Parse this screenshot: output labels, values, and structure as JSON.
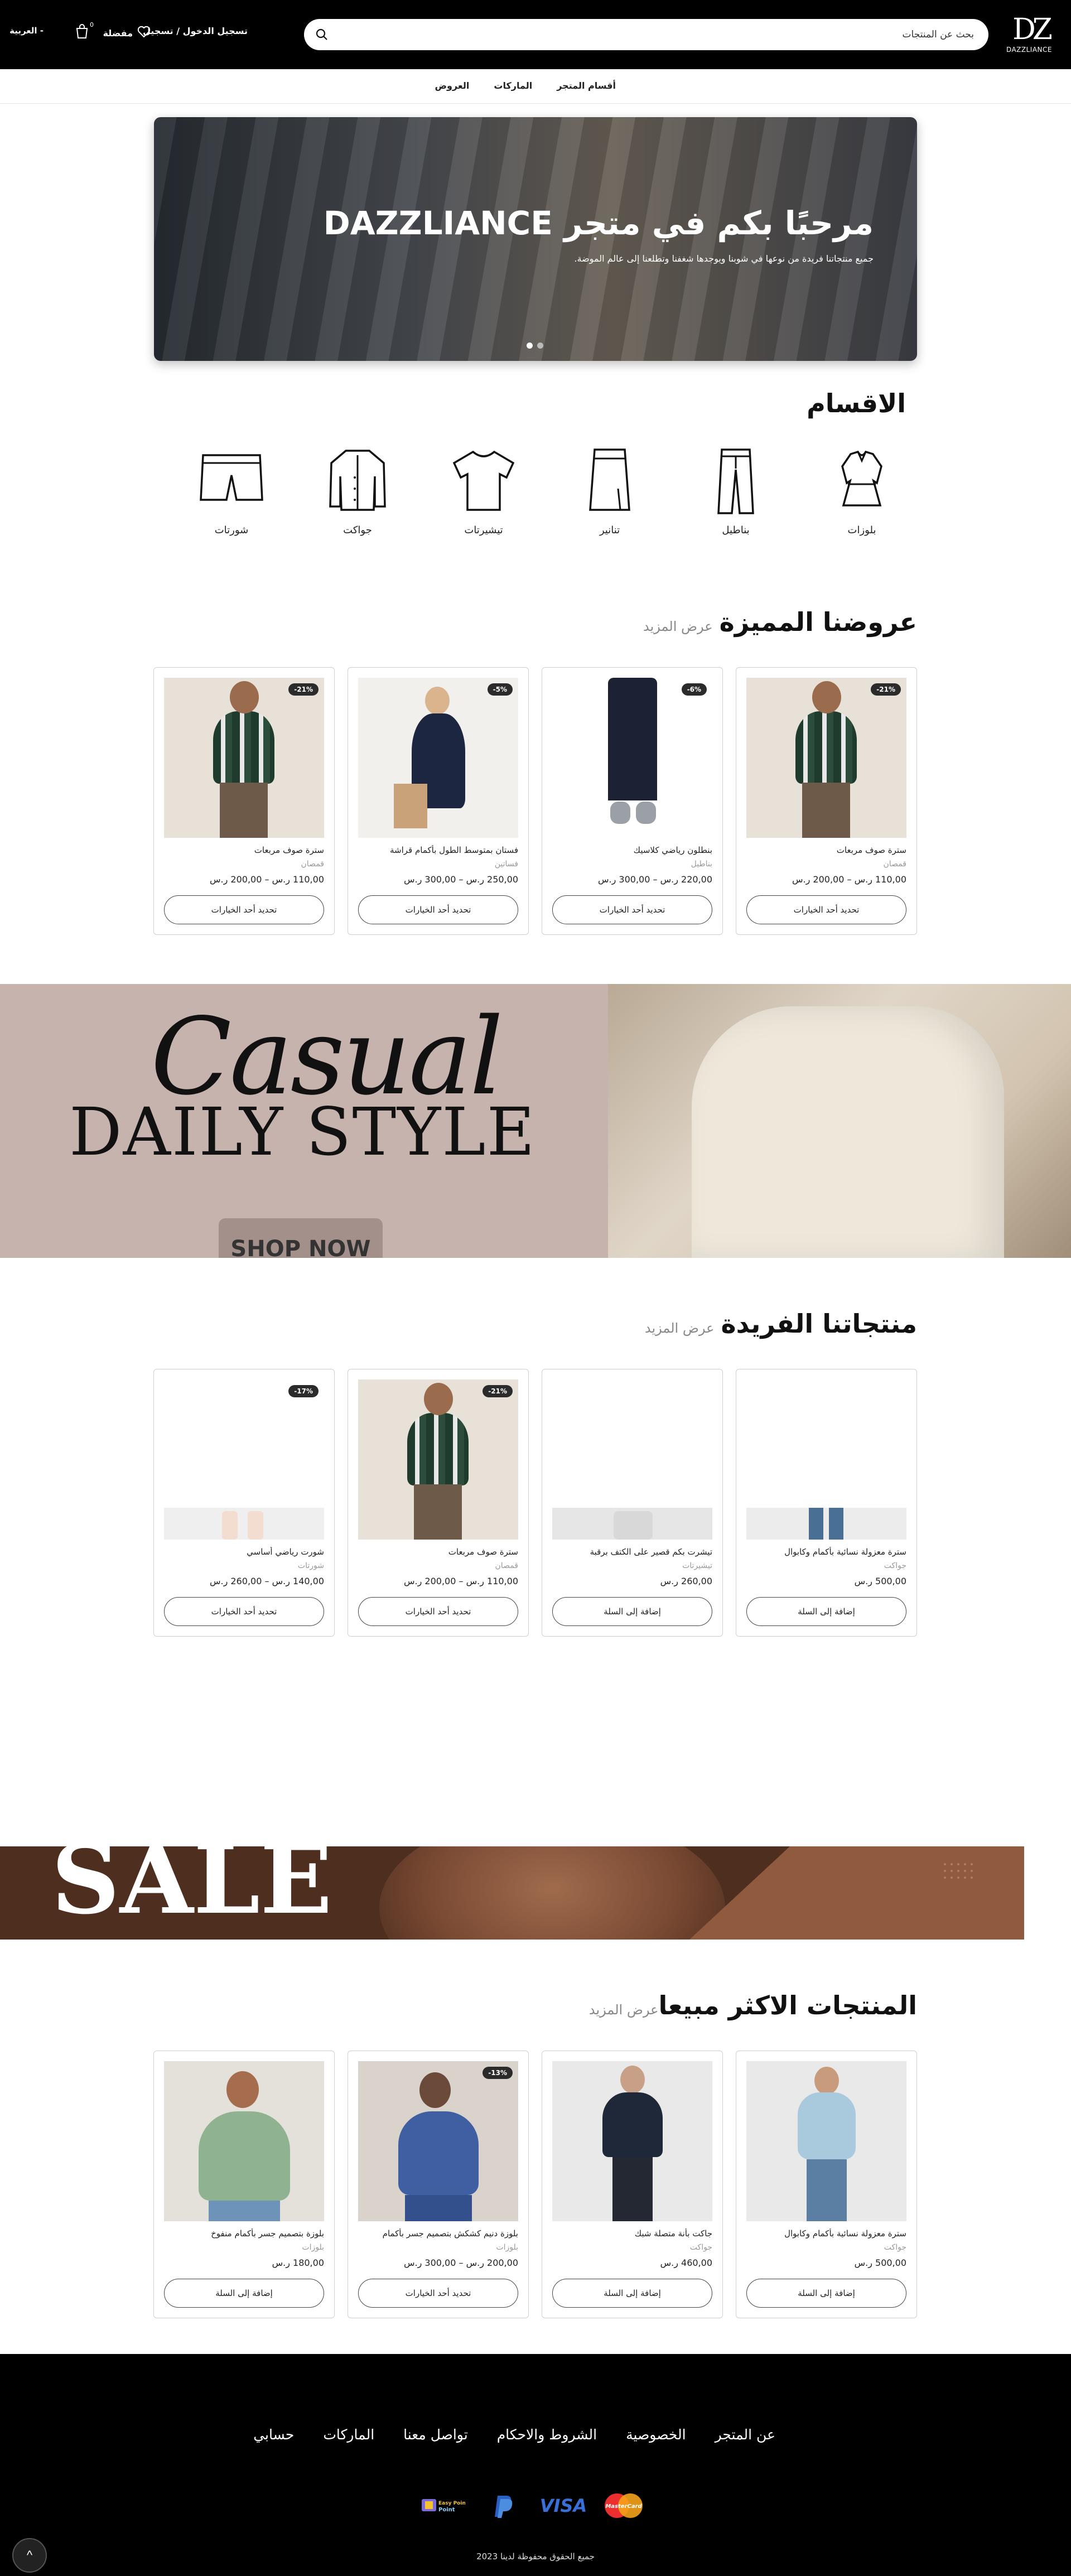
{
  "header": {
    "logo_text": "DAZZLIANCE",
    "logo_mark": "DZ",
    "search_placeholder": "بحث عن المنتجات",
    "login_label": "تسجيل الدخول / تسجيل",
    "favorites_label": "مفضلة",
    "cart_count": "0",
    "language_label": "- العربية"
  },
  "nav": {
    "items": [
      "أقسام المتجر",
      "الماركات",
      "العروض"
    ]
  },
  "hero": {
    "title": "مرحبًا بكم في متجر DAZZLIANCE",
    "subtitle": "جميع منتجاتنا فريدة من نوعها في شوبنا ويوجدها شغفنا وتطلعنا إلى عالم الموضة."
  },
  "categories": {
    "title": "الاقسام",
    "items": [
      {
        "label": "بلوزات",
        "icon": "blouse-icon"
      },
      {
        "label": "بناطيل",
        "icon": "pants-icon"
      },
      {
        "label": "تنانير",
        "icon": "skirt-icon"
      },
      {
        "label": "تيشيرتات",
        "icon": "tshirt-icon"
      },
      {
        "label": "جواكت",
        "icon": "jacket-icon"
      },
      {
        "label": "شورتات",
        "icon": "shorts-icon"
      }
    ]
  },
  "featured": {
    "title": "عروضنا المميزة",
    "view_more": "عرض المزيد",
    "products": [
      {
        "name": "سترة صوف مربعات",
        "category": "قمصان",
        "price": "110,00 ر.س – 200,00 ر.س",
        "discount": "-21%",
        "button": "تحديد أحد الخيارات"
      },
      {
        "name": "بنطلون رياضي كلاسيك",
        "category": "بناطيل",
        "price": "220,00 ر.س – 300,00 ر.س",
        "discount": "-6%",
        "button": "تحديد أحد الخيارات"
      },
      {
        "name": "فستان بمتوسط الطول بأكمام قراشة",
        "category": "فساتين",
        "price": "250,00 ر.س – 300,00 ر.س",
        "discount": "-5%",
        "button": "تحديد أحد الخيارات"
      },
      {
        "name": "سترة صوف مربعات",
        "category": "قمصان",
        "price": "110,00 ر.س – 200,00 ر.س",
        "discount": "-21%",
        "button": "تحديد أحد الخيارات"
      }
    ]
  },
  "casual_banner": {
    "script_text": "Casual",
    "headline": "DAILY STYLE",
    "button": "SHOP NOW"
  },
  "unique": {
    "title": "منتجاتنا الفريدة",
    "view_more": "عرض المزيد",
    "products": [
      {
        "name": "سترة معزولة نسائية بأكمام وكابوال",
        "category": "جواكت",
        "price": "500,00 ر.س",
        "discount": "",
        "button": "إضافة إلى السلة"
      },
      {
        "name": "تيشرت بكم قصير على الكتف برقبة",
        "category": "تيشيرتات",
        "price": "260,00 ر.س",
        "discount": "",
        "button": "إضافة إلى السلة"
      },
      {
        "name": "سترة صوف مربعات",
        "category": "قمصان",
        "price": "110,00 ر.س – 200,00 ر.س",
        "discount": "-21%",
        "button": "تحديد أحد الخيارات"
      },
      {
        "name": "شورت رياضي أساسي",
        "category": "شورتات",
        "price": "140,00 ر.س – 260,00 ر.س",
        "discount": "-17%",
        "button": "تحديد أحد الخيارات"
      }
    ]
  },
  "sale_banner": {
    "text": "SALE"
  },
  "bestsellers": {
    "title": "المنتجات الاكثر مبيعا",
    "view_more": "عرض المزيد",
    "products": [
      {
        "name": "سترة معزولة نسائية بأكمام وكابوال",
        "category": "جواكت",
        "price": "500,00 ر.س",
        "discount": "",
        "button": "إضافة إلى السلة"
      },
      {
        "name": "جاكت بأنة متصلة شبك",
        "category": "جواكت",
        "price": "460,00 ر.س",
        "discount": "",
        "button": "إضافة إلى السلة"
      },
      {
        "name": "بلوزة دنيم كشكش بتصميم جسر بأكمام",
        "category": "بلوزات",
        "price": "200,00 ر.س – 300,00 ر.س",
        "discount": "-13%",
        "button": "تحديد أحد الخيارات"
      },
      {
        "name": "بلوزة بتصميم جسر بأكمام منفوخ",
        "category": "بلوزات",
        "price": "180,00 ر.س",
        "discount": "",
        "button": "إضافة إلى السلة"
      }
    ]
  },
  "footer": {
    "links": [
      "عن المتجر",
      "الخصوصية",
      "الشروط والاحكام",
      "تواصل معنا",
      "الماركات",
      "حسابي"
    ],
    "payments": [
      "MasterCard",
      "VISA",
      "PayPal",
      "Easy Point"
    ],
    "copyright": "جميع الحقوق محفوظة لدينا 2023",
    "back_to_top": "^"
  },
  "colors": {
    "header_bg": "#000000",
    "footer_bg": "#000000",
    "discount_badge": "#2b2b2b",
    "casual_banner_bg": "#c6b3ad",
    "sale_banner_bg": "#4e2e1f"
  }
}
